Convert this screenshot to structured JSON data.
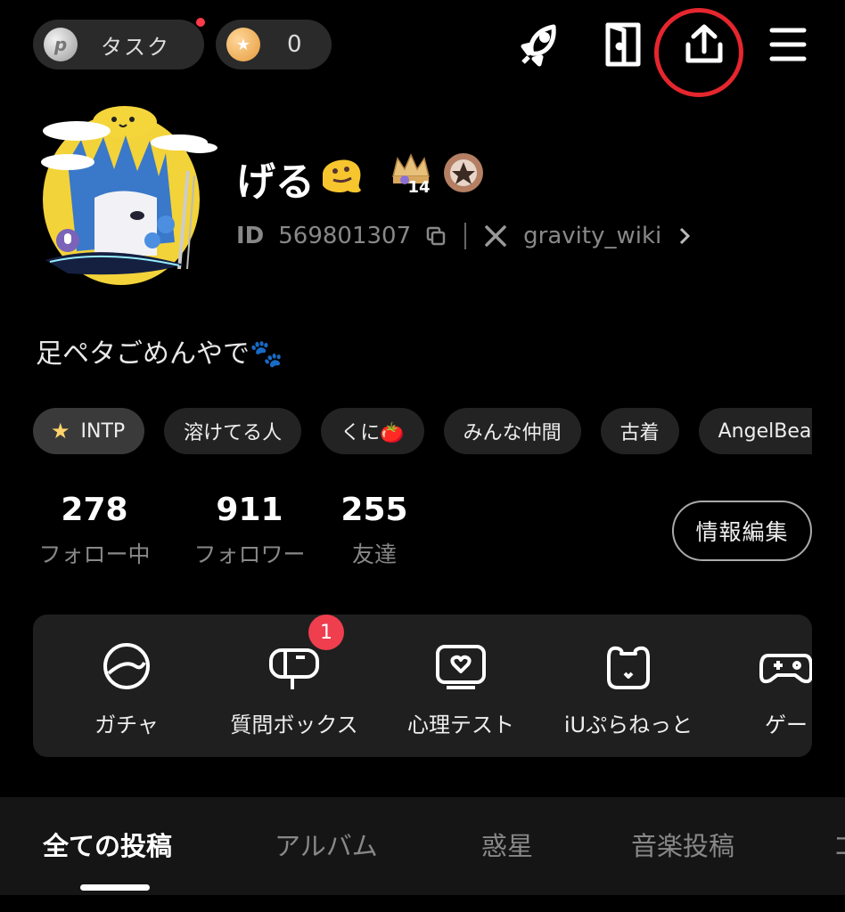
{
  "top": {
    "task_coin_symbol": "p",
    "task_label": "タスク",
    "coin_symbol": "★",
    "coin_count": "0",
    "icons": [
      "rocket-icon",
      "door-icon",
      "share-icon",
      "menu-icon"
    ],
    "highlight_color": "#e6262e"
  },
  "profile": {
    "name": "げる",
    "badge_level": "14",
    "id_label": "ID",
    "id_value": "569801307",
    "x_handle": "gravity_wiki",
    "bio": "足ペタごめんやで🐾"
  },
  "tags": [
    "INTP",
    "溶けてる人",
    "くに🍅",
    "みんな仲間",
    "古着",
    "AngelBeat"
  ],
  "stats": [
    {
      "num": "278",
      "label": "フォロー中"
    },
    {
      "num": "911",
      "label": "フォロワー"
    },
    {
      "num": "255",
      "label": "友達"
    }
  ],
  "edit_button": "情報編集",
  "features": [
    {
      "label": "ガチャ",
      "icon": "gacha-icon"
    },
    {
      "label": "質問ボックス",
      "icon": "mailbox-icon"
    },
    {
      "label": "心理テスト",
      "icon": "heart-screen-icon"
    },
    {
      "label": "iUぷらねっと",
      "icon": "bear-icon"
    },
    {
      "label": "ゲー",
      "icon": "gamepad-icon"
    }
  ],
  "question_badge": "1",
  "tabs": [
    "全ての投稿",
    "アルバム",
    "惑星",
    "音楽投稿",
    "コ"
  ],
  "accent_red": "#ef3e4e"
}
